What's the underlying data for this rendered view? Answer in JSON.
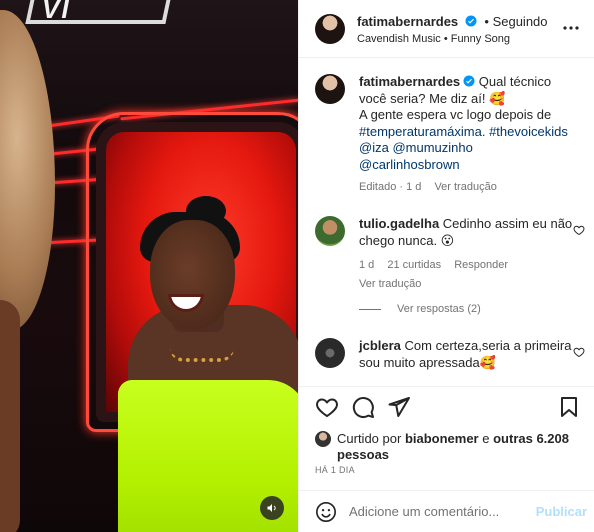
{
  "post": {
    "author": "fatimabernardes",
    "follow_status": "• Seguindo",
    "audio": "Cavendish Music • Funny Song"
  },
  "caption": {
    "username": "fatimabernardes",
    "text_part1": "Qual técnico você seria? Me diz aí! 🥰",
    "text_part2": "A gente espera vc logo depois de",
    "hashtag1": "#temperaturamáxima.",
    "hashtag2": "#thevoicekids",
    "mention1": "@iza",
    "mention2": "@mumuzinho",
    "mention3": "@carlinhosbrown",
    "meta_edited": "Editado · 1 d",
    "meta_translate": "Ver tradução"
  },
  "comments": [
    {
      "username": "tulio.gadelha",
      "text": "Cedinho assim eu não chego nunca. 😮",
      "age": "1 d",
      "likes": "21 curtidas",
      "reply": "Responder",
      "translate": "Ver tradução",
      "view_replies": "Ver respostas (2)"
    },
    {
      "username": "jcblera",
      "text": "Com certeza,seria a primeira sou muito apressada🥰"
    }
  ],
  "likes": {
    "prefix": "Curtido por",
    "user": "biabonemer",
    "middle": "e",
    "others": "outras 6.208 pessoas"
  },
  "time_ago": "HÁ 1 DIA",
  "add_comment": {
    "placeholder": "Adicione um comentário...",
    "post_label": "Publicar"
  },
  "media": {
    "sign_text": "VI"
  },
  "colors": {
    "link": "#00376b",
    "verified": "#0095f6",
    "publish_disabled": "#b2dffc",
    "dress": "#c8ff1e",
    "chair": "#e4180f"
  }
}
